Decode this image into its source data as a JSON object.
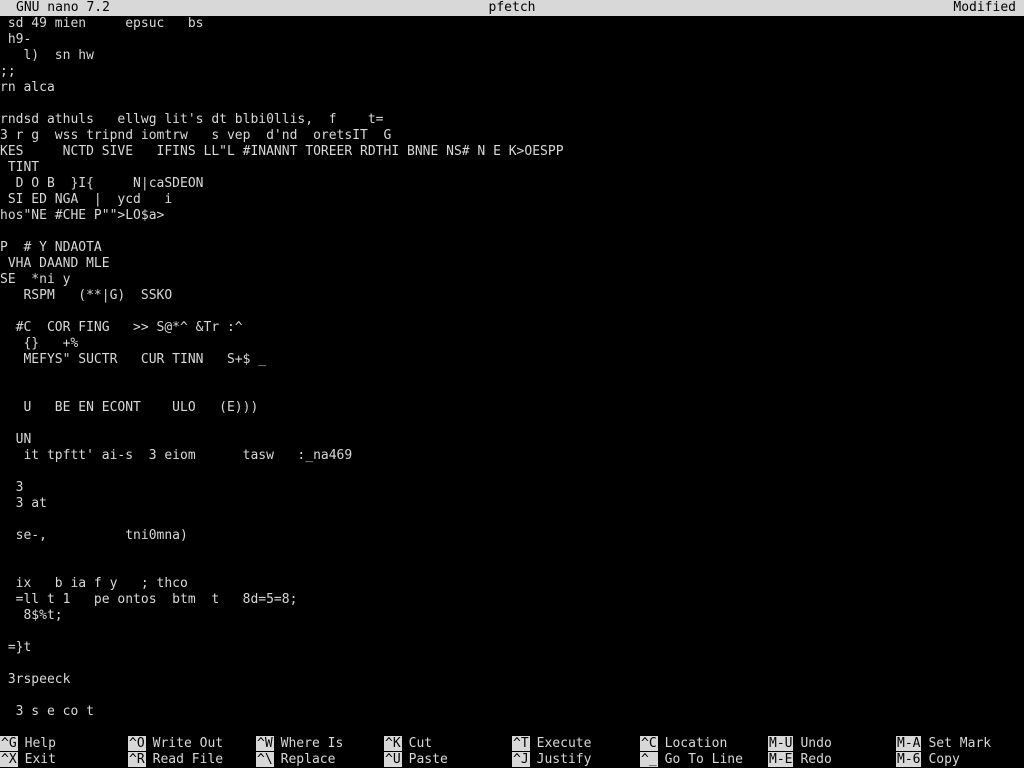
{
  "titlebar": {
    "app": "GNU nano 7.2",
    "filename": "pfetch",
    "status": "Modified"
  },
  "editor": {
    "lines": [
      " sd 49 mien     epsuc   bs",
      " h9-",
      "   l)  sn hw",
      ";;",
      "rn alca",
      "",
      "rndsd athuls   ellwg lit's dt blbi0llis,  f    t=",
      "3 r g  wss tripnd iomtrw   s vep  d'nd  oretsIT  G",
      "KES     NCTD SIVE   IFINS LL\"L #INANNT TOREER RDTHI BNNE NS# N E K>OESPP",
      " TINT",
      "  D O B  }I{     N|caSDEON",
      " SI ED NGA  |  ycd   i",
      "hos\"NE #CHE P\"\">LO$a>",
      "",
      "P  # Y NDAOTA",
      " VHA DAAND MLE",
      "SE  *ni y",
      "   RSPM   (**|G)  SSKO",
      "",
      "  #C  COR FING   >> S@*^ &Tr :^",
      "   {}   +%",
      "   MEFYS\" SUCTR   CUR TINN   S+$ _",
      "",
      "",
      "   U   BE EN ECONT    ULO   (E)))",
      "",
      "  UN",
      "   it tpftt' ai-s  3 eiom      tasw   :_na469",
      "",
      "  3",
      "  3 at",
      "",
      "  se-,          tni0mna)",
      "",
      "",
      "  ix   b ia f y   ; thco",
      "  =ll t 1   pe ontos  btm  t   8d=5=8;",
      "   8$%t;",
      "",
      " =}t",
      "",
      " 3rspeeck",
      "",
      "  3 s e co t"
    ]
  },
  "shortcuts": [
    {
      "key": "^G",
      "label": "Help"
    },
    {
      "key": "^X",
      "label": "Exit"
    },
    {
      "key": "^O",
      "label": "Write Out"
    },
    {
      "key": "^R",
      "label": "Read File"
    },
    {
      "key": "^W",
      "label": "Where Is"
    },
    {
      "key": "^\\",
      "label": "Replace"
    },
    {
      "key": "^K",
      "label": "Cut"
    },
    {
      "key": "^U",
      "label": "Paste"
    },
    {
      "key": "^T",
      "label": "Execute"
    },
    {
      "key": "^J",
      "label": "Justify"
    },
    {
      "key": "^C",
      "label": "Location"
    },
    {
      "key": "^_",
      "label": "Go To Line"
    },
    {
      "key": "M-U",
      "label": "Undo"
    },
    {
      "key": "M-E",
      "label": "Redo"
    },
    {
      "key": "M-A",
      "label": "Set Mark"
    },
    {
      "key": "M-6",
      "label": "Copy"
    }
  ]
}
